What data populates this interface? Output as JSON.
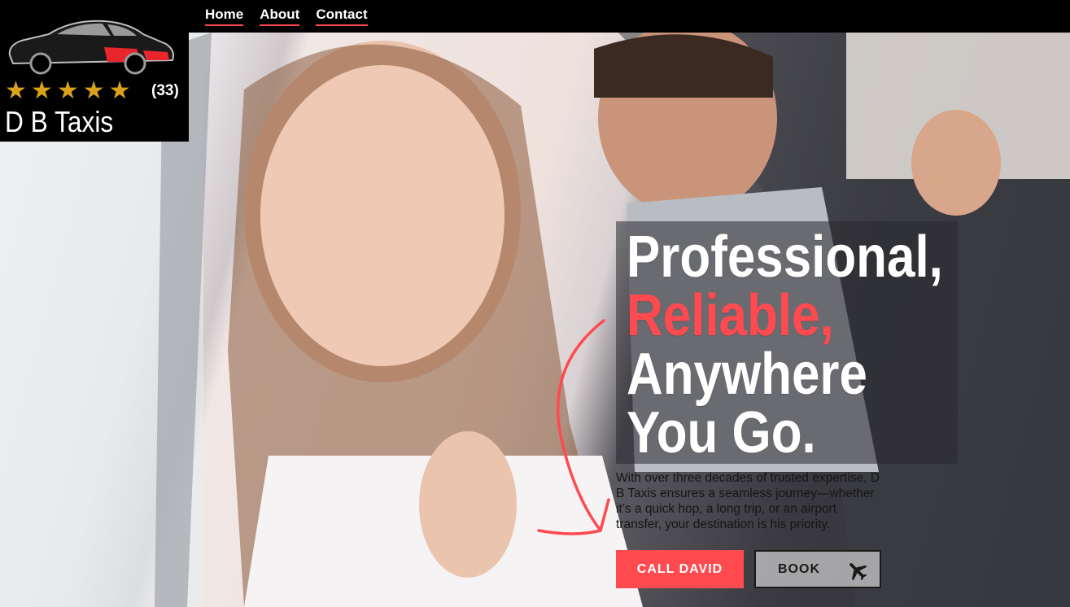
{
  "nav": {
    "items": [
      {
        "label": "Home"
      },
      {
        "label": "About"
      },
      {
        "label": "Contact"
      }
    ]
  },
  "brand": {
    "name": "D B Taxis",
    "rating_stars": 5,
    "review_count": "(33)",
    "colors": {
      "star": "#d9a21a",
      "accent": "#ff4a4f"
    }
  },
  "hero": {
    "headline_line1": "Professional,",
    "headline_line2": "Reliable,",
    "headline_line3": "Anywhere",
    "headline_line4": "You Go.",
    "subtext": "With over three decades of trusted expertise, D B Taxis ensures a seamless journey—whether it’s a quick hop, a long trip, or an airport transfer, your destination is his priority.",
    "call_button": "CALL DAVID",
    "book_button": "BOOK",
    "book_icon": "airplane-icon"
  }
}
